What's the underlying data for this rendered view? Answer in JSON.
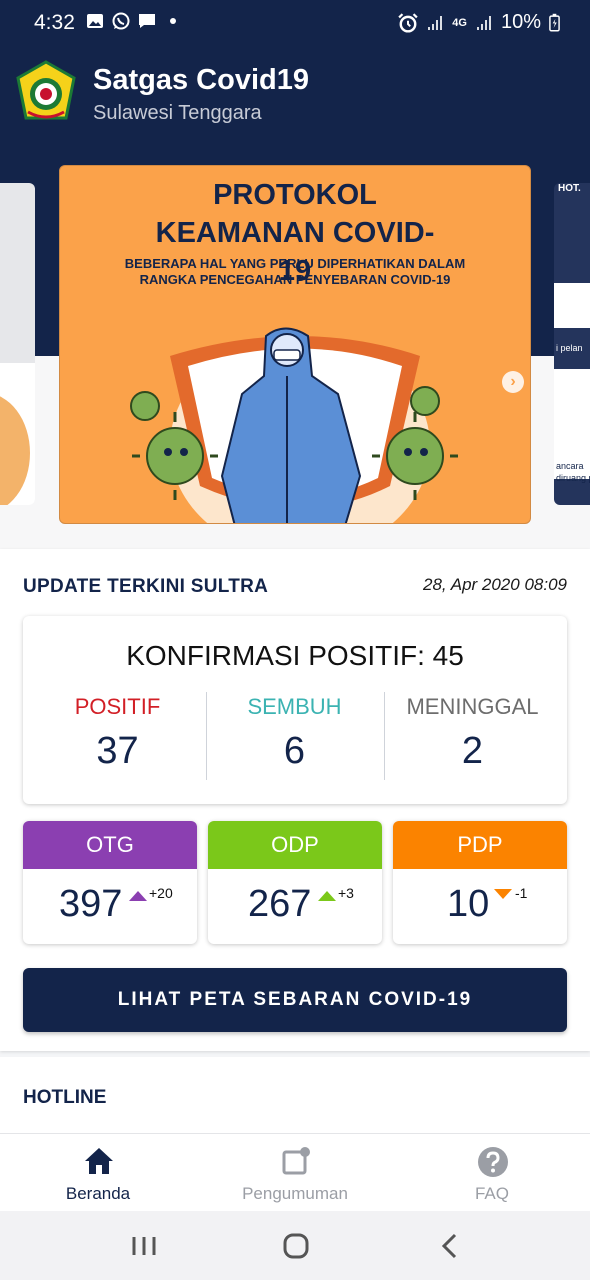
{
  "status_bar": {
    "time": "4:32",
    "battery": "10%",
    "network_label": "4G"
  },
  "header": {
    "title": "Satgas Covid19",
    "subtitle": "Sulawesi Tenggara"
  },
  "carousel": {
    "slide_title": "PROTOKOL KEAMANAN COVID-19",
    "slide_subtitle": "BEBERAPA HAL YANG PERLU DIPERHATIKAN DALAM RANGKA PENCEGAHAN PENYEBARAN COVID-19",
    "next_slide_text_1": "i pelan",
    "next_slide_text_2": "ancara",
    "next_slide_text_3": "diruang p",
    "next_slide_header": "HOT."
  },
  "update": {
    "title": "UPDATE TERKINI SULTRA",
    "timestamp": "28, Apr 2020 08:09",
    "konfirmasi_label": "KONFIRMASI POSITIF: 45",
    "positif_label": "POSITIF",
    "positif_value": "37",
    "sembuh_label": "SEMBUH",
    "sembuh_value": "6",
    "meninggal_label": "MENINGGAL",
    "meninggal_value": "2",
    "otg_label": "OTG",
    "otg_value": "397",
    "otg_delta": "+20",
    "odp_label": "ODP",
    "odp_value": "267",
    "odp_delta": "+3",
    "pdp_label": "PDP",
    "pdp_value": "10",
    "pdp_delta": "-1",
    "map_button": "LIHAT PETA SEBARAN COVID-19"
  },
  "hotline": {
    "title": "HOTLINE"
  },
  "bottom_nav": {
    "home": "Beranda",
    "announcements": "Pengumuman",
    "faq": "FAQ"
  },
  "colors": {
    "navy": "#13244a",
    "positif": "#d21f26",
    "sembuh": "#3bb3b2",
    "meninggal": "#6d6d6d",
    "otg": "#8b3fb1",
    "odp": "#7bc81a",
    "pdp": "#fb8300",
    "slide_orange": "#fba24a"
  }
}
